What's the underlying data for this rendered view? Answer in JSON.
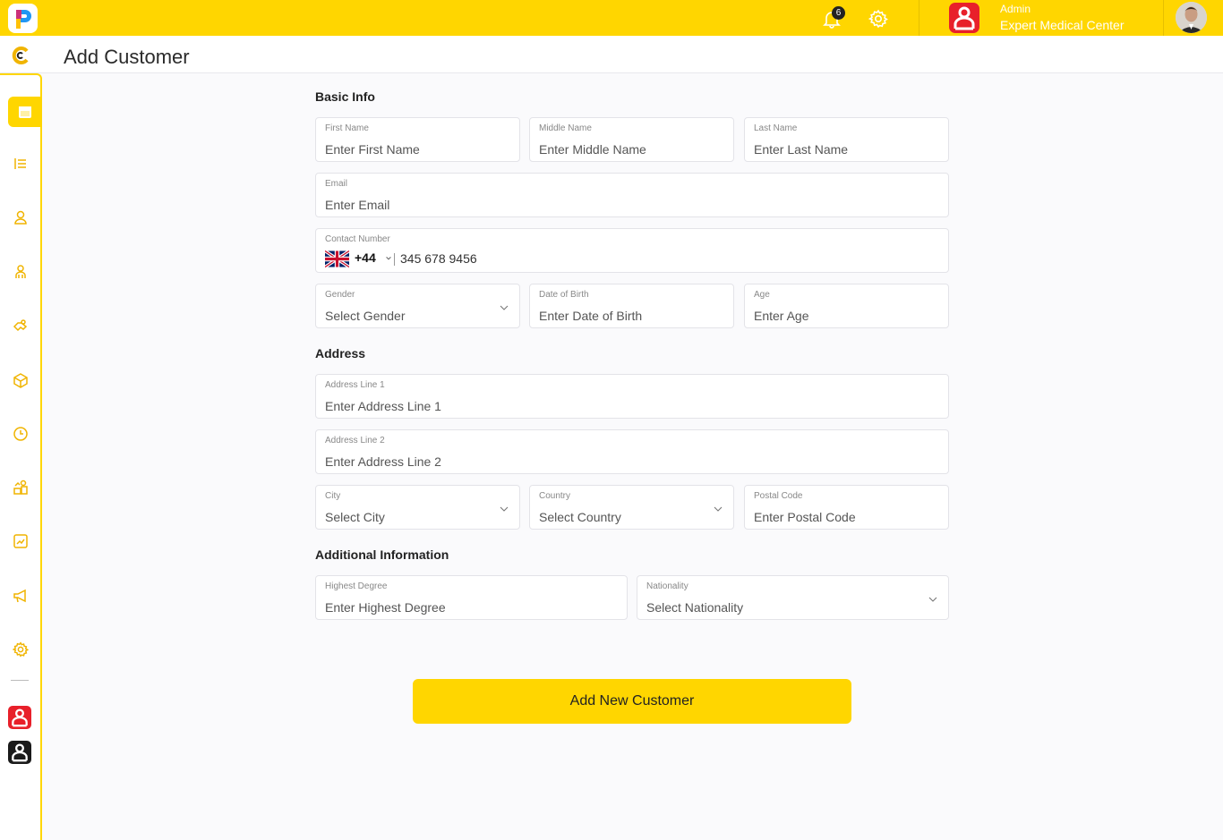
{
  "topbar": {
    "notification_count": "6",
    "org_role": "Admin",
    "org_name": "Expert Medical Center"
  },
  "page": {
    "title": "Add Customer"
  },
  "sidebar": {
    "items": [
      "calendar-icon",
      "list-icon",
      "user-icon",
      "staff-icon",
      "handshake-icon",
      "box-icon",
      "clock-icon",
      "coins-icon",
      "chart-icon",
      "megaphone-icon",
      "settings-icon"
    ],
    "active_index": 0
  },
  "sections": {
    "basic": "Basic Info",
    "address": "Address",
    "additional": "Additional Information"
  },
  "fields": {
    "first_name": {
      "label": "First Name",
      "placeholder": "Enter First Name"
    },
    "middle_name": {
      "label": "Middle Name",
      "placeholder": "Enter Middle Name"
    },
    "last_name": {
      "label": "Last Name",
      "placeholder": "Enter Last Name"
    },
    "email": {
      "label": "Email",
      "placeholder": "Enter Email"
    },
    "contact": {
      "label": "Contact Number",
      "dial_code": "+44",
      "value": "345 678 9456"
    },
    "gender": {
      "label": "Gender",
      "placeholder": "Select Gender"
    },
    "dob": {
      "label": "Date of Birth",
      "placeholder": "Enter Date of Birth"
    },
    "age": {
      "label": "Age",
      "placeholder": "Enter Age"
    },
    "address1": {
      "label": "Address Line 1",
      "placeholder": "Enter Address Line 1"
    },
    "address2": {
      "label": "Address Line 2",
      "placeholder": "Enter Address Line 2"
    },
    "city": {
      "label": "City",
      "placeholder": "Select City"
    },
    "country": {
      "label": "Country",
      "placeholder": "Select Country"
    },
    "postal": {
      "label": "Postal Code",
      "placeholder": "Enter Postal Code"
    },
    "degree": {
      "label": "Highest Degree",
      "placeholder": "Enter Highest Degree"
    },
    "nationality": {
      "label": "Nationality",
      "placeholder": "Select Nationality"
    }
  },
  "actions": {
    "submit": "Add New Customer"
  },
  "colors": {
    "accent": "#ffd600",
    "brand_red": "#e8202a"
  }
}
